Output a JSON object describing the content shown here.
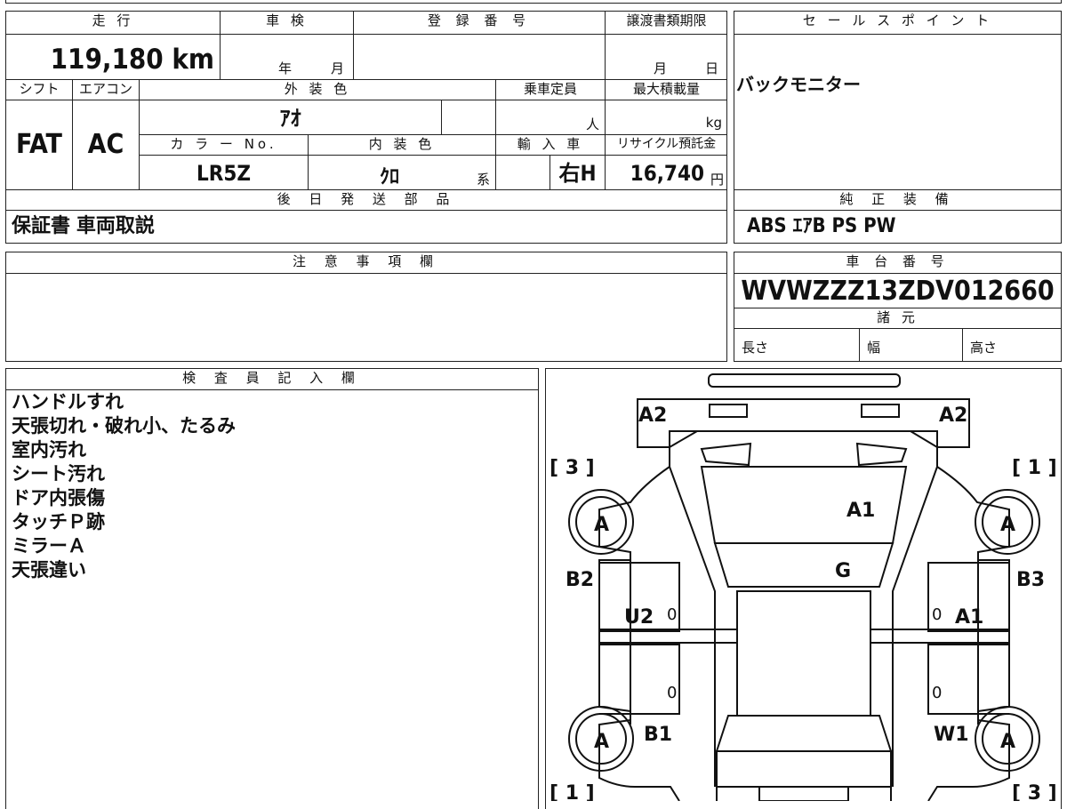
{
  "main": {
    "headers": {
      "mileage": "走 行",
      "inspection": "車 検",
      "registration": "登 録 番 号",
      "transfer_deadline": "譲渡書類期限",
      "shift": "シフト",
      "aircon": "エアコン",
      "exterior_color": "外 装 色",
      "capacity": "乗車定員",
      "max_load": "最大積載量",
      "color_no": "カ ラ ー No.",
      "interior_color": "内 装 色",
      "import": "輸 入 車",
      "recycle": "リサイクル預託金",
      "later_parts": "後 日 発 送 部 品"
    },
    "values": {
      "mileage": "119,180 km",
      "inspection_year_unit": "年",
      "inspection_month_unit": "月",
      "transfer_month_unit": "月",
      "transfer_day_unit": "日",
      "shift": "FAT",
      "aircon": "AC",
      "exterior_color": "ｱｵ",
      "capacity_unit": "人",
      "max_load_unit": "kg",
      "color_no": "LR5Z",
      "interior_color": "ｸﾛ",
      "interior_suffix": "系",
      "import": "右H",
      "recycle": "16,740",
      "recycle_unit": "円",
      "later_parts": "保証書 車両取説"
    }
  },
  "sales": {
    "header": "セ ー ル ス ポ イ ン ト",
    "text": "バックモニター",
    "equipment_header": "純 正 装 備",
    "equipment": "ABS ｴｱB PS PW"
  },
  "caution": {
    "header": "注 意 事 項 欄"
  },
  "chassis": {
    "header": "車 台 番 号",
    "number": "WVWZZZ13ZDV012660",
    "specs_header": "諸 元",
    "length": "長さ",
    "width": "幅",
    "height": "高さ"
  },
  "inspector": {
    "header": "検 査 員 記 入 欄",
    "notes": [
      "ハンドルすれ",
      "天張切れ・破れ小、たるみ",
      "室内汚れ",
      "シート汚れ",
      "ドア内張傷",
      "タッチＰ跡",
      "ミラーＡ",
      "天張違い"
    ]
  },
  "diagram": {
    "a2_left": "A2",
    "a2_right": "A2",
    "tire_left_top": "[ 3 ]",
    "tire_right_top": "[ 1 ]",
    "tire_left_bottom": "[ 1 ]",
    "tire_right_bottom": "[ 3 ]",
    "wheel_fl": "A",
    "wheel_fr": "A",
    "wheel_rl": "A",
    "wheel_rr": "A",
    "hood": "A1",
    "windshield": "G",
    "left_fender": "B2",
    "right_fender": "B3",
    "left_front_door": "U2",
    "right_front_door": "A1",
    "left_rear": "B1",
    "right_rear": "W1",
    "zero_1": "0",
    "zero_2": "0",
    "zero_3": "0",
    "zero_4": "0"
  }
}
